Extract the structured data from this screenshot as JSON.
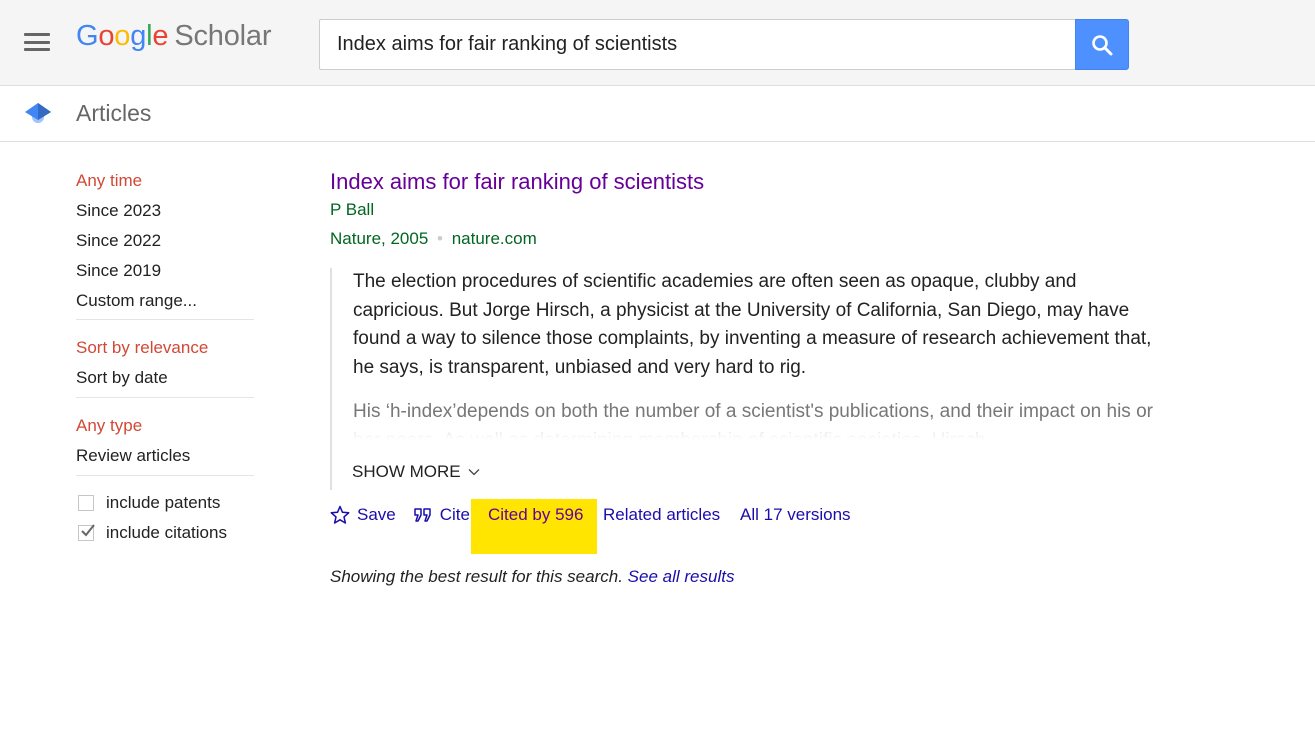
{
  "header": {
    "logo": {
      "google": [
        "G",
        "o",
        "o",
        "g",
        "l",
        "e"
      ],
      "product": "Scholar"
    },
    "search": {
      "value": "Index aims for fair ranking of scientists",
      "placeholder": ""
    },
    "icons": {
      "menu": "hamburger-menu-icon",
      "search": "search-icon"
    }
  },
  "subheader": {
    "label": "Articles",
    "icon": "graduation-cap-icon"
  },
  "sidebar": {
    "time_filters": [
      {
        "label": "Any time",
        "active": true
      },
      {
        "label": "Since 2023",
        "active": false
      },
      {
        "label": "Since 2022",
        "active": false
      },
      {
        "label": "Since 2019",
        "active": false
      },
      {
        "label": "Custom range...",
        "active": false
      }
    ],
    "sort_options": [
      {
        "label": "Sort by relevance",
        "active": true
      },
      {
        "label": "Sort by date",
        "active": false
      }
    ],
    "type_filters": [
      {
        "label": "Any type",
        "active": true
      },
      {
        "label": "Review articles",
        "active": false
      }
    ],
    "checkboxes": [
      {
        "label": "include patents",
        "checked": false
      },
      {
        "label": "include citations",
        "checked": true
      }
    ]
  },
  "result": {
    "title": "Index aims for fair ranking of scientists",
    "authors": "P Ball",
    "venue": "Nature, 2005",
    "separator": "•",
    "source": "nature.com",
    "abstract_p1": "The election procedures of scientific academies are often seen as opaque, clubby and capricious. But Jorge Hirsch, a physicist at the University of California, San Diego, may have found a way to silence those complaints, by inventing a measure of research achievement that, he says, is transparent, unbiased and very hard to rig.",
    "abstract_p2": "His ‘h-index’depends on both the number of a scientist's publications, and their impact on his or her peers. As well as determining membership of scientific societies, Hirsch",
    "show_more": "SHOW MORE",
    "actions": {
      "save": "Save",
      "cite": "Cite",
      "cited_by": "Cited by 596",
      "related": "Related articles",
      "versions": "All 17 versions"
    },
    "highlight_color": "#ffe500"
  },
  "footer_note": {
    "text": "Showing the best result for this search.",
    "link": "See all results"
  },
  "colors": {
    "accent_red": "#d14836",
    "link_blue": "#1a0dab",
    "visited_purple": "#660099",
    "green": "#006621",
    "search_button": "#4d90fe"
  }
}
